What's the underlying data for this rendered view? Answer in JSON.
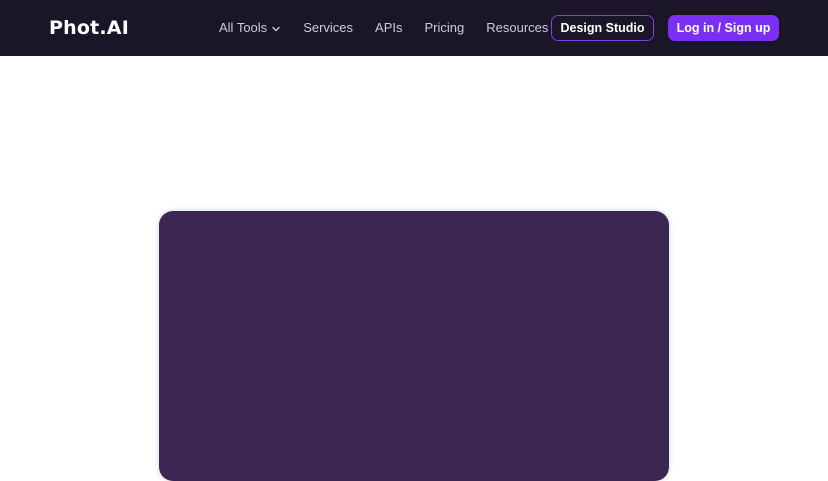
{
  "brand": {
    "logo_text": "Phot.AI"
  },
  "nav": {
    "items": [
      {
        "label": "All Tools",
        "has_dropdown": true,
        "icon": "chevron-down-icon"
      },
      {
        "label": "Services"
      },
      {
        "label": "APIs"
      },
      {
        "label": "Pricing"
      },
      {
        "label": "Resources"
      }
    ]
  },
  "actions": {
    "design_studio_label": "Design Studio",
    "login_label": "Log in / Sign up"
  },
  "colors": {
    "navbar_bg": "#1a1527",
    "accent": "#7a2ff3",
    "card_bg": "#3c2753"
  }
}
